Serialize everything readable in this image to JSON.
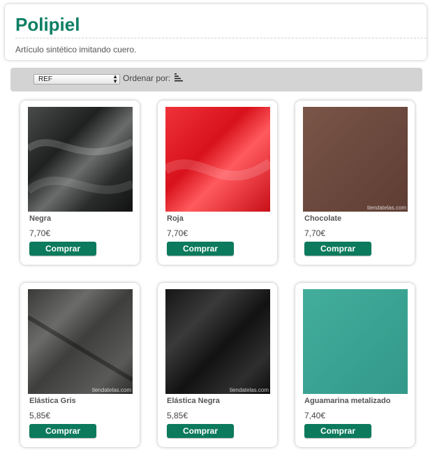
{
  "header": {
    "title": "Polipiel",
    "subtitle": "Artículo sintético imitando cuero."
  },
  "toolbar": {
    "sort_select_value": "REF",
    "sort_label": "Ordenar por:",
    "sort_icon": "sort-descending-icon"
  },
  "products": [
    {
      "name": "Negra",
      "price": "7,70€",
      "button": "Comprar",
      "color": "#2a2c2c",
      "watermark": ""
    },
    {
      "name": "Roja",
      "price": "7,70€",
      "button": "Comprar",
      "color": "#e8202a",
      "watermark": ""
    },
    {
      "name": "Chocolate",
      "price": "7,70€",
      "button": "Comprar",
      "color": "#6e4a3e",
      "watermark": "tiendatelas.com"
    },
    {
      "name": "Elástica Gris",
      "price": "5,85€",
      "button": "Comprar",
      "color": "#4a4a48",
      "watermark": "tiendatelas.com"
    },
    {
      "name": "Elástica Negra",
      "price": "5,85€",
      "button": "Comprar",
      "color": "#1c1c1c",
      "watermark": "tiendatelas.com"
    },
    {
      "name": "Aguamarina metalizado",
      "price": "7,40€",
      "button": "Comprar",
      "color": "#3aa392",
      "watermark": ""
    }
  ],
  "colors": {
    "accent": "#0d7f64",
    "button": "#0c7a5c",
    "toolbar": "#d3d3d3"
  }
}
